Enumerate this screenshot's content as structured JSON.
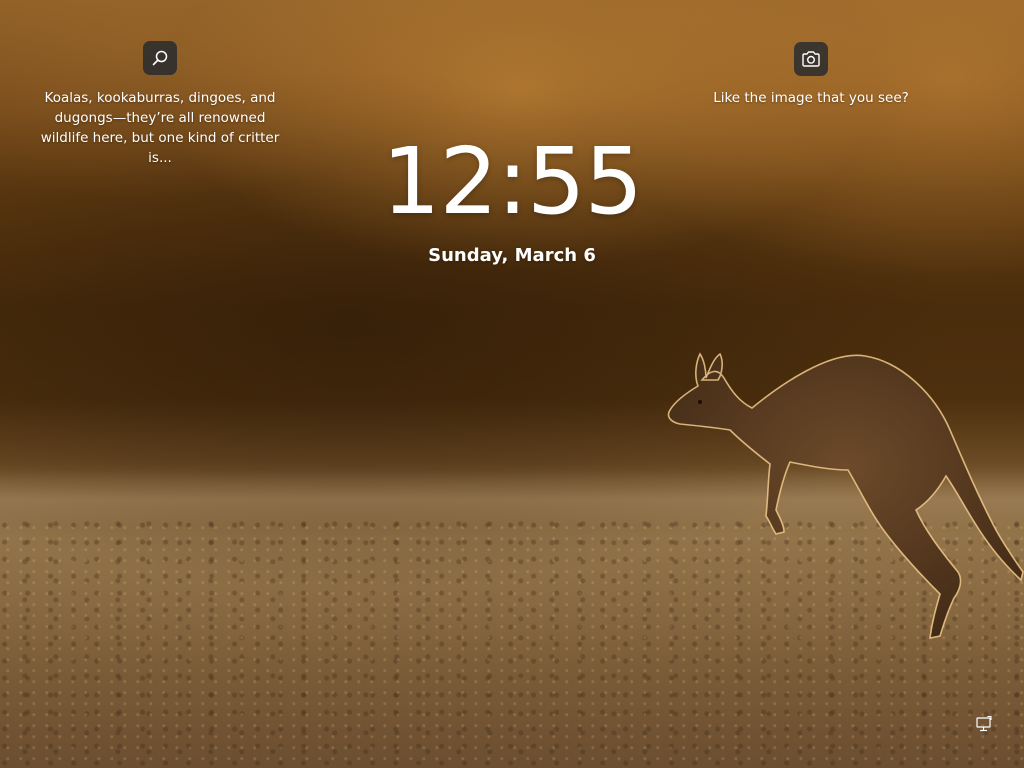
{
  "lock_screen": {
    "time": "12:55",
    "date": "Sunday, March 6"
  },
  "widgets": {
    "search": {
      "icon": "search-icon",
      "text": "Koalas, kookaburras, dingoes, and dugongs—they’re all renowned wildlife here, but one kind of critter is..."
    },
    "spotlight": {
      "icon": "camera-icon",
      "text": "Like the image that you see?"
    }
  },
  "status": {
    "network_icon": "network-icon"
  },
  "colors": {
    "widget_button_bg": "#20263099",
    "text": "#ffffff"
  }
}
